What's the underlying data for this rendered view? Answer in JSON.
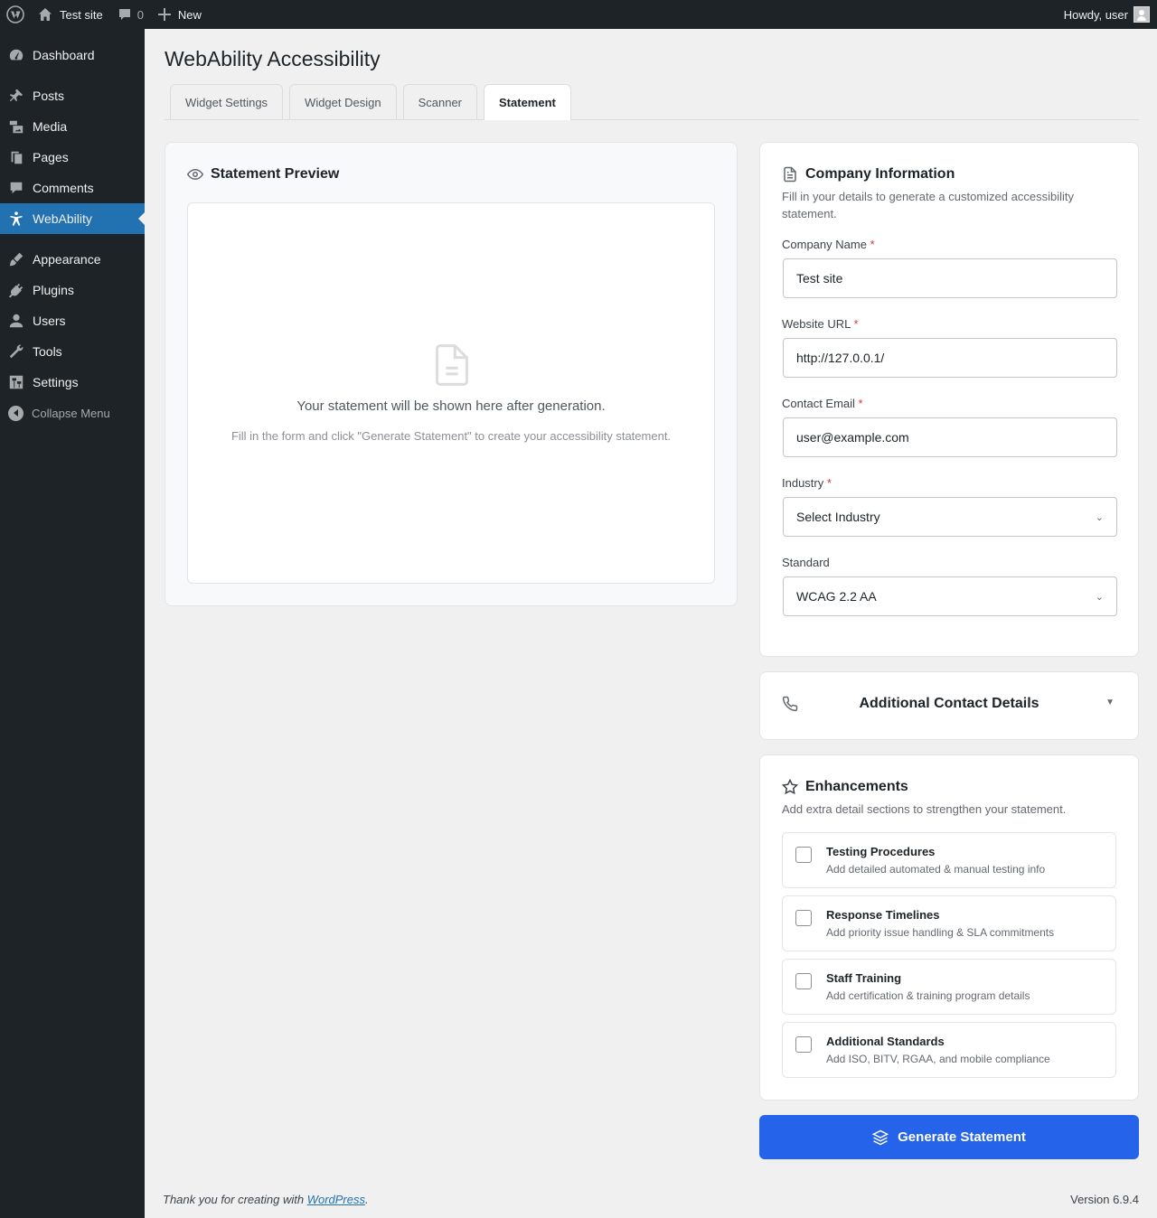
{
  "adminbar": {
    "site_name": "Test site",
    "comments_count": "0",
    "new_label": "New",
    "howdy": "Howdy, user"
  },
  "sidebar": {
    "items": [
      {
        "label": "Dashboard",
        "icon": "dashboard-icon"
      },
      {
        "label": "Posts",
        "icon": "pin-icon"
      },
      {
        "label": "Media",
        "icon": "media-icon"
      },
      {
        "label": "Pages",
        "icon": "pages-icon"
      },
      {
        "label": "Comments",
        "icon": "comment-icon"
      },
      {
        "label": "WebAbility",
        "icon": "accessibility-icon"
      },
      {
        "label": "Appearance",
        "icon": "brush-icon"
      },
      {
        "label": "Plugins",
        "icon": "plugin-icon"
      },
      {
        "label": "Users",
        "icon": "user-icon"
      },
      {
        "label": "Tools",
        "icon": "wrench-icon"
      },
      {
        "label": "Settings",
        "icon": "settings-icon"
      }
    ],
    "collapse_label": "Collapse Menu"
  },
  "page": {
    "title": "WebAbility Accessibility",
    "tabs": [
      "Widget Settings",
      "Widget Design",
      "Scanner",
      "Statement"
    ],
    "active_tab": "Statement"
  },
  "preview": {
    "title": "Statement Preview",
    "empty_title": "Your statement will be shown here after generation.",
    "empty_sub": "Fill in the form and click \"Generate Statement\" to create your accessibility statement."
  },
  "company": {
    "title": "Company Information",
    "description": "Fill in your details to generate a customized accessibility statement.",
    "fields": {
      "company_name": {
        "label": "Company Name",
        "required": "*",
        "value": "Test site"
      },
      "website_url": {
        "label": "Website URL",
        "required": "*",
        "value": "http://127.0.0.1/"
      },
      "contact_email": {
        "label": "Contact Email",
        "required": "*",
        "value": "user@example.com"
      },
      "industry": {
        "label": "Industry",
        "required": "*",
        "value": "Select Industry"
      },
      "standard": {
        "label": "Standard",
        "value": "WCAG 2.2 AA"
      }
    }
  },
  "contact": {
    "title": "Additional Contact Details"
  },
  "enhancements": {
    "title": "Enhancements",
    "description": "Add extra detail sections to strengthen your statement.",
    "options": [
      {
        "title": "Testing Procedures",
        "desc": "Add detailed automated & manual testing info"
      },
      {
        "title": "Response Timelines",
        "desc": "Add priority issue handling & SLA commitments"
      },
      {
        "title": "Staff Training",
        "desc": "Add certification & training program details"
      },
      {
        "title": "Additional Standards",
        "desc": "Add ISO, BITV, RGAA, and mobile compliance"
      }
    ]
  },
  "generate_label": "Generate Statement",
  "footer": {
    "thanks_prefix": "Thank you for creating with ",
    "wp_link": "WordPress",
    "thanks_suffix": ".",
    "version": "Version 6.9.4"
  },
  "colors": {
    "accent": "#2271b1",
    "button": "#2563eb",
    "sidebar_bg": "#1d2327"
  }
}
